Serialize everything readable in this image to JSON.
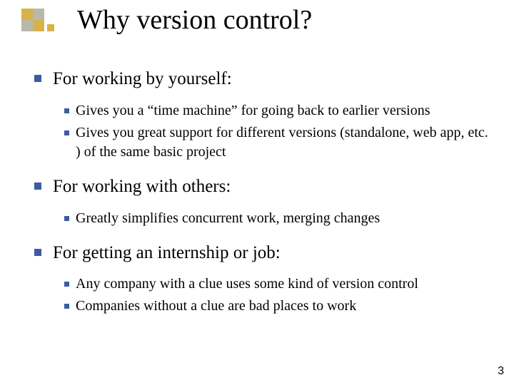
{
  "title": "Why version control?",
  "page_number": "3",
  "sections": [
    {
      "heading": "For working by yourself:",
      "items": [
        "Gives you a “time machine” for going back to earlier versions",
        "Gives you great support for different versions (standalone, web app, etc. ) of the same basic project"
      ]
    },
    {
      "heading": "For working with others:",
      "items": [
        "Greatly simplifies concurrent work, merging changes"
      ]
    },
    {
      "heading": "For getting an internship or job:",
      "items": [
        "Any company with a clue uses some kind of version control",
        "Companies without a clue are bad places to work"
      ]
    }
  ]
}
